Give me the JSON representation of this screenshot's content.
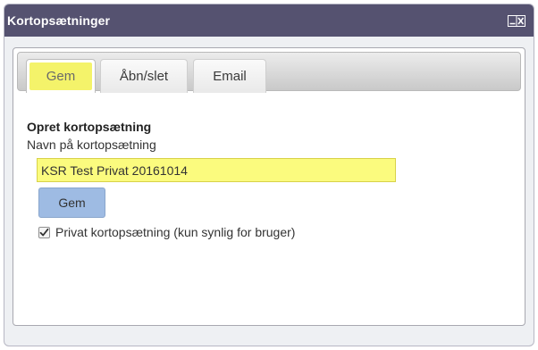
{
  "dialog": {
    "title": "Kortopsætninger",
    "window_control_icon": "minimize-close-icon"
  },
  "tabs": [
    {
      "label": "Gem",
      "active": true,
      "highlighted": true
    },
    {
      "label": "Åbn/slet",
      "active": false
    },
    {
      "label": "Email",
      "active": false
    }
  ],
  "form": {
    "section_title": "Opret kortopsætning",
    "field_label": "Navn på kortopsætning",
    "name_value": "KSR Test Privat 20161014",
    "save_label": "Gem",
    "private_checked": true,
    "private_label": "Privat kortopsætning (kun synlig for bruger)"
  },
  "colors": {
    "titlebar": "#555270",
    "highlight": "#f4f36a",
    "button": "#9ebbe3"
  }
}
